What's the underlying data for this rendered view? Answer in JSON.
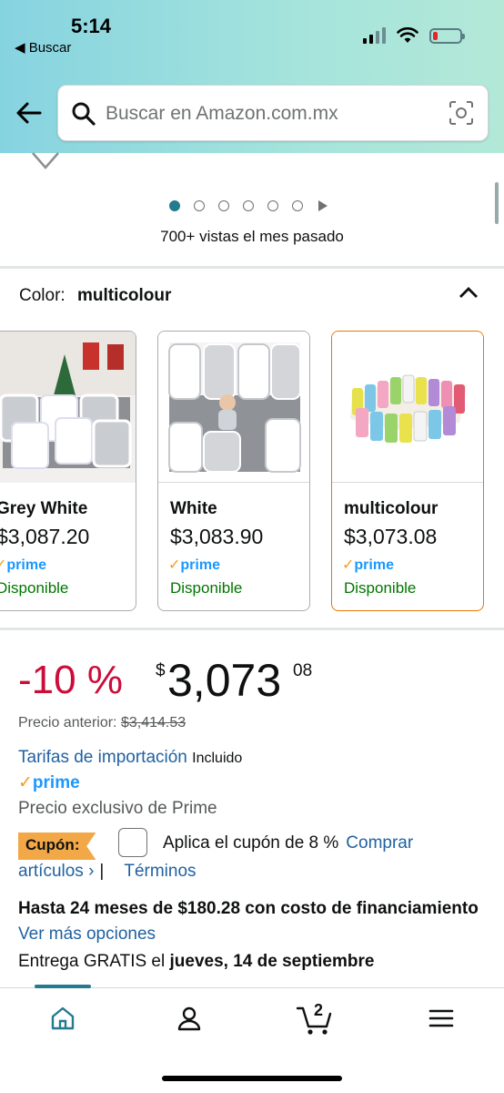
{
  "status_bar": {
    "time": "5:14",
    "back_label": "◀ Buscar",
    "battery_level": 0.15
  },
  "search": {
    "placeholder": "Buscar en Amazon.com.mx"
  },
  "carousel": {
    "dot_count": 6,
    "active_index": 0,
    "views_text": "700+ vistas el mes pasado"
  },
  "color_selector": {
    "label": "Color:",
    "selected": "multicolour",
    "options": [
      {
        "name": "Grey White",
        "price": "$3,087.20",
        "prime": "prime",
        "availability": "Disponible"
      },
      {
        "name": "White",
        "price": "$3,083.90",
        "prime": "prime",
        "availability": "Disponible"
      },
      {
        "name": "multicolour",
        "price": "$3,073.08",
        "prime": "prime",
        "availability": "Disponible"
      }
    ]
  },
  "pricing": {
    "discount": "-10 %",
    "currency_symbol": "$",
    "price_whole": "3,073",
    "price_cents": "08",
    "previous_label": "Precio anterior:",
    "previous_price": "$3,414.53",
    "import_fees_link": "Tarifas de importación",
    "import_fees_status": "Incluido",
    "prime_label": "prime",
    "prime_exclusive": "Precio exclusivo de Prime"
  },
  "coupon": {
    "badge": "Cupón:",
    "text": "Aplica el cupón de 8 %",
    "link_part1": "Comprar",
    "link_part2": "artículos ›",
    "separator": "|",
    "terms": "Términos"
  },
  "financing": {
    "text": "Hasta 24 meses de $180.28 con costo de financiamiento",
    "link": "Ver más opciones"
  },
  "delivery": {
    "prefix": "Entrega GRATIS el",
    "date": "jueves, 14 de septiembre"
  },
  "bottom_nav": {
    "cart_count": "2",
    "items": [
      "home-icon",
      "account-icon",
      "cart-icon",
      "menu-icon"
    ]
  },
  "colors": {
    "accent": "#247a8f",
    "link": "#2162a1",
    "discount": "#cc0c39",
    "available": "#007600",
    "coupon": "#f3a847",
    "selected_border": "#e77600"
  }
}
